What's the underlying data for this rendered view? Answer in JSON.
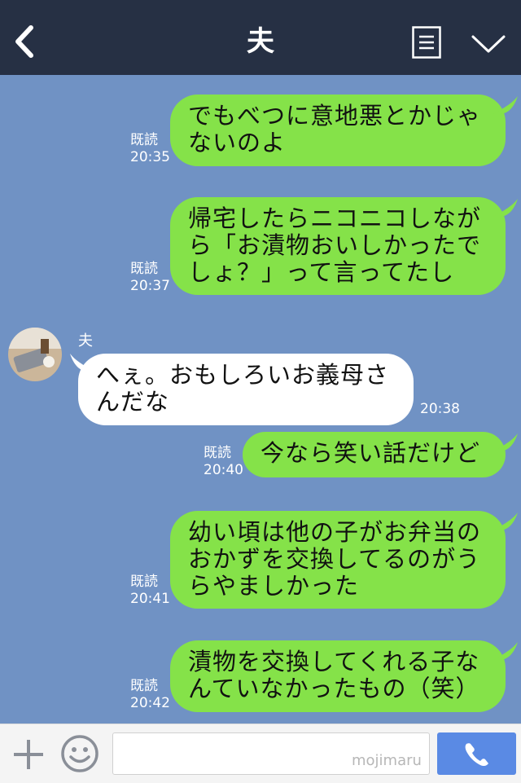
{
  "header": {
    "title": "夫"
  },
  "messages": [
    {
      "side": "out",
      "lines": [
        "でもべつに意地悪とかじゃ",
        "ないのよ"
      ],
      "read": "既読",
      "time": "20:35"
    },
    {
      "side": "out",
      "lines": [
        "帰宅したらニコニコしなが",
        "ら「お漬物おいしかったで",
        "しょ？」って言ってたし"
      ],
      "read": "既読",
      "time": "20:37"
    },
    {
      "side": "in",
      "sender": "夫",
      "lines": [
        "へぇ。おもしろいお義母さ",
        "んだな"
      ],
      "time": "20:38"
    },
    {
      "side": "out",
      "lines": [
        "今なら笑い話だけど"
      ],
      "read": "既読",
      "time": "20:40"
    },
    {
      "side": "out",
      "lines": [
        "幼い頃は他の子がお弁当の",
        "おかずを交換してるのがう",
        "らやましかった"
      ],
      "read": "既読",
      "time": "20:41"
    },
    {
      "side": "out",
      "lines": [
        "漬物を交換してくれる子な",
        "んていなかったもの（笑）"
      ],
      "read": "既読",
      "time": "20:42"
    }
  ],
  "footer": {
    "watermark": "mojimaru",
    "input_value": ""
  },
  "colors": {
    "header": "#263044",
    "chat_bg": "#7092c4",
    "outgoing_bubble": "#85e249",
    "incoming_bubble": "#ffffff",
    "call_button": "#5a8ae4"
  }
}
